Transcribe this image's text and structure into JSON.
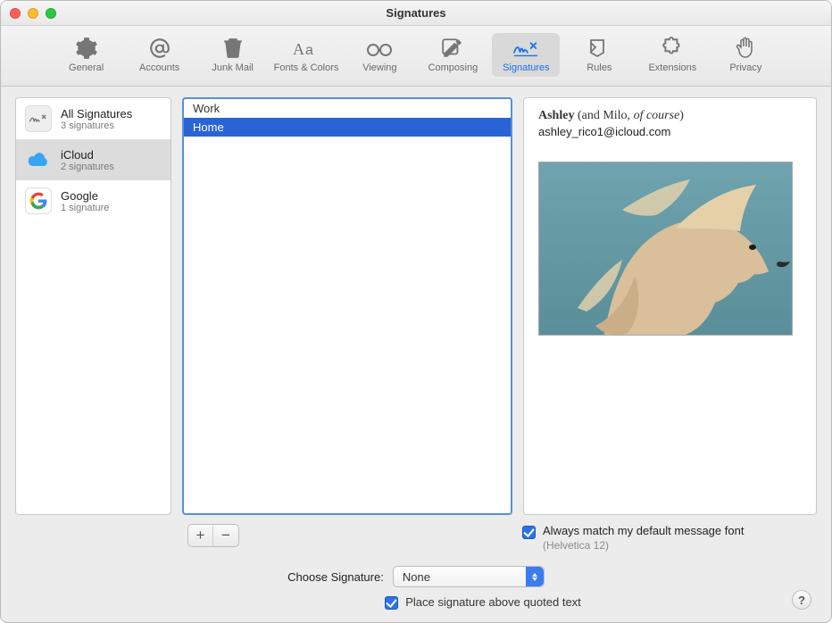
{
  "window": {
    "title": "Signatures"
  },
  "toolbar": {
    "items": [
      {
        "label": "General"
      },
      {
        "label": "Accounts"
      },
      {
        "label": "Junk Mail"
      },
      {
        "label": "Fonts & Colors"
      },
      {
        "label": "Viewing"
      },
      {
        "label": "Composing"
      },
      {
        "label": "Signatures"
      },
      {
        "label": "Rules"
      },
      {
        "label": "Extensions"
      },
      {
        "label": "Privacy"
      }
    ]
  },
  "accounts": [
    {
      "name": "All Signatures",
      "subtitle": "3 signatures"
    },
    {
      "name": "iCloud",
      "subtitle": "2 signatures"
    },
    {
      "name": "Google",
      "subtitle": "1 signature"
    }
  ],
  "signatures": [
    {
      "name": "Work"
    },
    {
      "name": "Home"
    }
  ],
  "preview": {
    "name": "Ashley",
    "paren": "(and Milo, ",
    "ital": "of course",
    "paren_close": ")",
    "email": "ashley_rico1@icloud.com"
  },
  "match_font": {
    "label": "Always match my default message font",
    "font": "(Helvetica 12)"
  },
  "choose": {
    "label": "Choose Signature:",
    "value": "None"
  },
  "place": {
    "label": "Place signature above quoted text"
  },
  "buttons": {
    "add": "+",
    "remove": "−",
    "help": "?"
  }
}
